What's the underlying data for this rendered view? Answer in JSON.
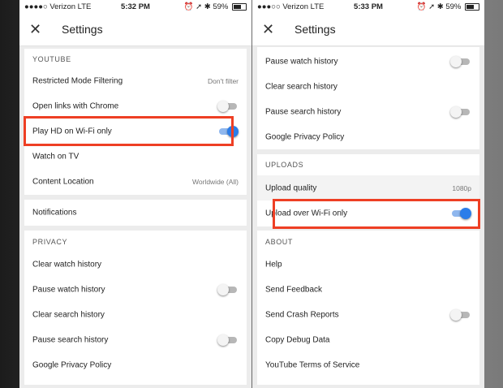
{
  "colors": {
    "highlight": "#ee3f24",
    "toggle_on": "#2b7de9"
  },
  "left": {
    "status": {
      "carrier": "●●●●○ Verizon  LTE",
      "time": "5:32 PM",
      "icons": "⏰ ➚ ✱",
      "battery": "59%",
      "battery_level": 0.59
    },
    "toolbar": {
      "close_icon": "✕",
      "title": "Settings"
    },
    "youtube": {
      "header": "YOUTUBE",
      "restricted": {
        "label": "Restricted Mode Filtering",
        "value": "Don't filter"
      },
      "open_links": {
        "label": "Open links with Chrome",
        "on": false
      },
      "play_hd": {
        "label": "Play HD on Wi-Fi only",
        "on": true
      },
      "watch_tv": {
        "label": "Watch on TV"
      },
      "content_location": {
        "label": "Content Location",
        "value": "Worldwide (All)"
      }
    },
    "notifications": {
      "label": "Notifications"
    },
    "privacy": {
      "header": "PRIVACY",
      "clear_watch": "Clear watch history",
      "pause_watch": "Pause watch history",
      "clear_search": "Clear search history",
      "pause_search": "Pause search history",
      "policy": "Google Privacy Policy"
    }
  },
  "right": {
    "status": {
      "carrier": "●●●○○ Verizon  LTE",
      "time": "5:33 PM",
      "icons": "⏰ ➚ ✱",
      "battery": "59%",
      "battery_level": 0.59
    },
    "toolbar": {
      "close_icon": "✕",
      "title": "Settings"
    },
    "privacy": {
      "pause_watch": "Pause watch history",
      "clear_search": "Clear search history",
      "pause_search": "Pause search history",
      "policy": "Google Privacy Policy"
    },
    "uploads": {
      "header": "UPLOADS",
      "quality": {
        "label": "Upload quality",
        "value": "1080p"
      },
      "wifi_only": {
        "label": "Upload over Wi-Fi only",
        "on": true
      }
    },
    "about": {
      "header": "ABOUT",
      "help": "Help",
      "feedback": "Send Feedback",
      "crash_reports": {
        "label": "Send Crash Reports",
        "on": false
      },
      "debug": "Copy Debug Data",
      "terms": "YouTube Terms of Service"
    }
  }
}
